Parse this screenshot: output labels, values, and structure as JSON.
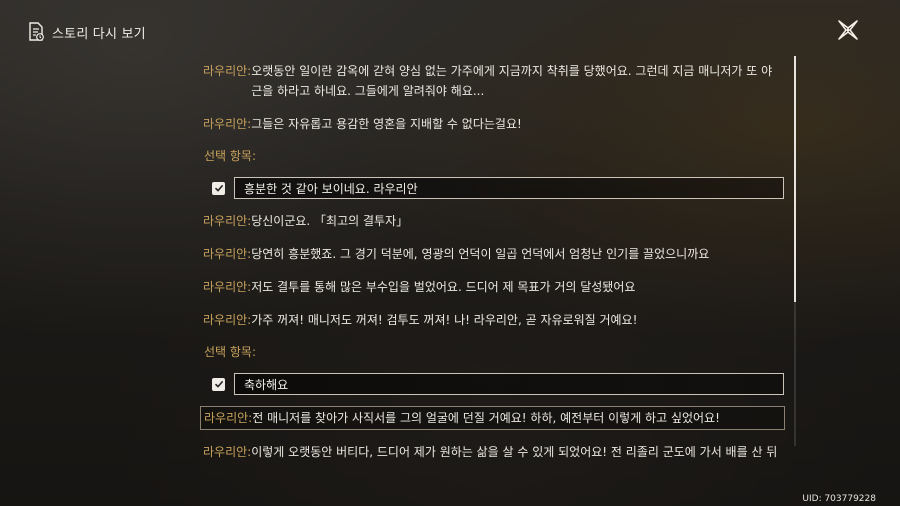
{
  "header": {
    "title": "스토리 다시 보기"
  },
  "entries": [
    {
      "speaker": "라우리안:",
      "text": "오랫동안 일이란 감옥에 갇혀 양심 없는 가주에게 지금까지 착취를 당했어요. 그런데 지금 매니저가 또 야근을 하라고 하네요. 그들에게 알려줘야 해요..."
    },
    {
      "speaker": "라우리안:",
      "text": "그들은 자유롭고 용감한 영혼을 지배할 수 없다는걸요!"
    },
    {
      "select_label": "선택 항목:"
    },
    {
      "choice": "흥분한 것 같아 보이네요. 라우리안"
    },
    {
      "speaker": "라우리안:",
      "text": "당신이군요. 「최고의 결투자」"
    },
    {
      "speaker": "라우리안:",
      "text": "당연히 흥분했죠. 그 경기 덕분에, 영광의 언덕이 일곱 언덕에서 엄청난 인기를 끌었으니까요"
    },
    {
      "speaker": "라우리안:",
      "text": "저도 결투를 통해 많은 부수입을 벌었어요. 드디어 제 목표가 거의 달성됐어요"
    },
    {
      "speaker": "라우리안:",
      "text": "가주 꺼져! 매니저도 꺼져! 검투도 꺼져! 나! 라우리안, 곧 자유로워질 거예요!"
    },
    {
      "select_label": "선택 항목:"
    },
    {
      "choice": "축하해요"
    },
    {
      "speaker": "라우리안:",
      "text": "전 매니저를 찾아가 사직서를 그의 얼굴에 던질 거예요! 하하, 예전부터 이렇게 하고 싶었어요!"
    },
    {
      "speaker": "라우리안:",
      "text": "이렇게 오랫동안 버티다, 드디어 제가 원하는 삶을 살 수 있게 되었어요! 전 리졸리 군도에 가서 배를 산 뒤 자유로운"
    }
  ],
  "footer": {
    "uid": "UID: 703779228"
  },
  "icons": {
    "history": "story-replay-icon",
    "close": "close-x-icon",
    "check": "checkmark-icon"
  },
  "colors": {
    "speaker": "#c8a25c",
    "text": "#ece9e2"
  }
}
